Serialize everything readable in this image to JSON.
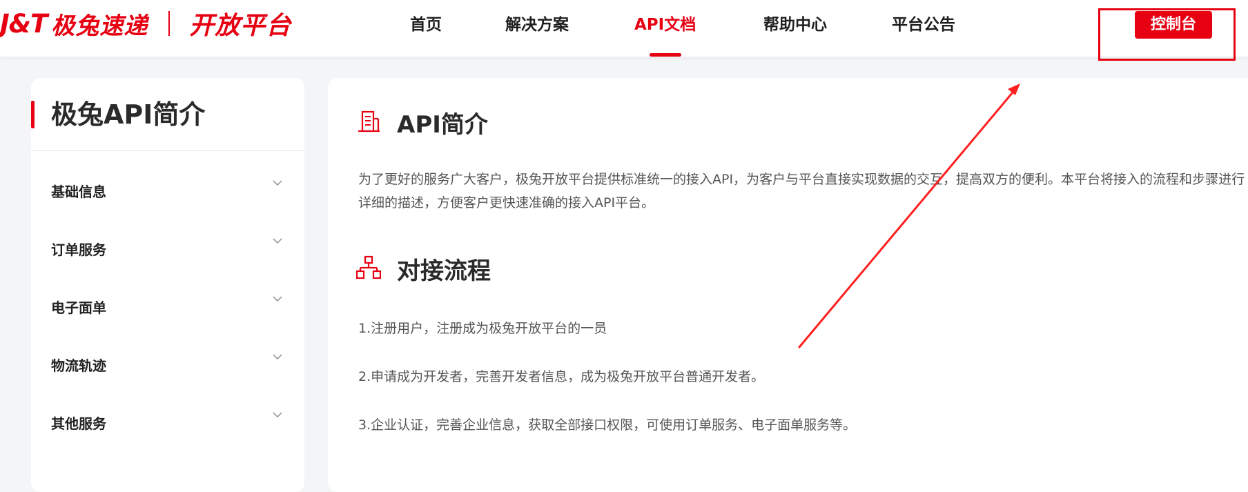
{
  "header": {
    "logo": {
      "brand": "J&T",
      "brand_cn": "极兔速递",
      "subtitle": "开放平台"
    },
    "nav": [
      "首页",
      "解决方案",
      "API文档",
      "帮助中心",
      "平台公告"
    ],
    "active_nav": "API文档",
    "console_label": "控制台"
  },
  "sidebar": {
    "title": "极兔API简介",
    "items": [
      "基础信息",
      "订单服务",
      "电子面单",
      "物流轨迹",
      "其他服务"
    ]
  },
  "main": {
    "section1": {
      "icon": "building-icon",
      "title": "API简介",
      "paragraph": "为了更好的服务广大客户，极兔开放平台提供标准统一的接入API，为客户与平台直接实现数据的交互，提高双方的便利。本平台将接入的流程和步骤进行详细的描述，方便客户更快速准确的接入API平台。"
    },
    "section2": {
      "icon": "flowchart-icon",
      "title": "对接流程",
      "steps": [
        "1.注册用户，注册成为极兔开放平台的一员",
        "2.申请成为开发者，完善开发者信息，成为极兔开放平台普通开发者。",
        "3.企业认证，完善企业信息，获取全部接口权限，可使用订单服务、电子面单服务等。"
      ]
    }
  },
  "colors": {
    "accent": "#e60012",
    "annotation": "#ff2020"
  }
}
